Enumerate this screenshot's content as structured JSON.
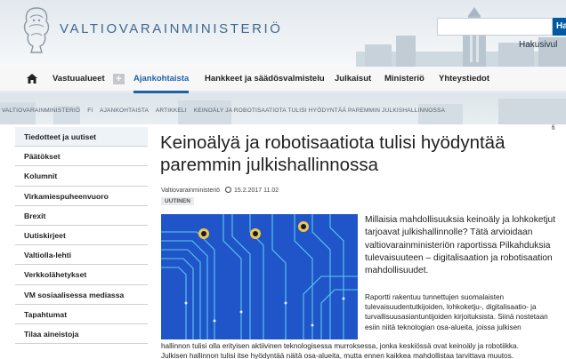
{
  "header": {
    "ministry_name": "VALTIOVARAINMINISTERIÖ",
    "search_button": "Ha",
    "search_placeholder": "",
    "advanced_search": "Hakusivul"
  },
  "nav": {
    "items": [
      {
        "label": "Vastuualueet"
      },
      {
        "label": "Ajankohtaista"
      },
      {
        "label": "Hankkeet ja säädösvalmistelu"
      },
      {
        "label": "Julkaisut"
      },
      {
        "label": "Ministeriö"
      },
      {
        "label": "Yhteystiedot"
      }
    ],
    "plus": "+"
  },
  "breadcrumb": {
    "items": [
      "VALTIOVARAINMINISTERIÖ",
      "FI",
      "AJANKOHTAISTA",
      "ARTIKKELI",
      "KEINOÄLY JA ROBOTISAATIOTA TULISI HYÖDYNTÄÄ PAREMMIN JULKISHALLINNOSSA"
    ]
  },
  "lang": "fi",
  "sidebar": {
    "items": [
      {
        "label": "Tiedotteet ja uutiset"
      },
      {
        "label": "Päätökset"
      },
      {
        "label": "Kolumnit"
      },
      {
        "label": "Virkamiespuheenvuoro"
      },
      {
        "label": "Brexit"
      },
      {
        "label": "Uutiskirjeet"
      },
      {
        "label": "Valtiolla-lehti"
      },
      {
        "label": "Verkkolähetykset"
      },
      {
        "label": "VM sosiaalisessa mediassa"
      },
      {
        "label": "Tapahtumat"
      },
      {
        "label": "Tilaa aineistoja"
      }
    ]
  },
  "article": {
    "title": "Keinoälyä ja robotisaatiota tulisi hyödyntää paremmin julkishallinnossa",
    "author": "Valtiovarainministeriö",
    "date": "15.2.2017 11.02",
    "badge": "UUTINEN",
    "lead_lines": [
      "Millaisia mahdollisuuksia keinoäly ja lohkoketjut",
      "tarjoavat julkishallinnolle? Tätä arvioidaan",
      "valtiovarainministeriön raportissa Pilkahduksia",
      "tulevaisuuteen – digitalisaation ja robotisaation",
      "mahdollisuudet."
    ],
    "body_lines": [
      "Raportti rakentuu tunnettujen suomalaisten",
      "tulevaisuudentutkijoiden, lohkoketju-, digitalisaatio- ja",
      "turvallisuusasiantuntijoiden kirjoituksista. Siinä nostetaan",
      "esiin niitä teknologian osa-alueita, joissa julkisen"
    ],
    "body_full_lines": [
      "hallinnon tulisi olla erityisen aktiivinen teknologisessa murroksessa, jonka keskiössä ovat keinoäly ja robotiikka.",
      "Julkisen hallinnon tulisi itse hyödyntää näitä osa-alueita, mutta ennen kaikkea mahdollistaa tarvittava muutos."
    ]
  }
}
